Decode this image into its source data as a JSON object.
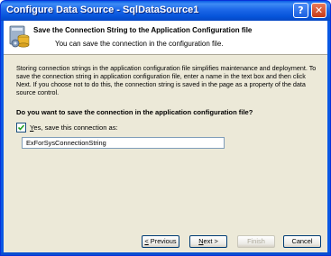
{
  "window": {
    "title": "Configure Data Source - SqlDataSource1",
    "help_label": "?",
    "close_label": "✕"
  },
  "header": {
    "title": "Save the Connection String to the Application Configuration file",
    "subtitle": "You can save the connection in the configuration file."
  },
  "body": {
    "description": "Storing connection strings in the application configuration file simplifies maintenance and deployment. To save the connection string in application configuration file, enter a name in the text box and then click Next. If you choose not to do this, the connection string is saved in the page as a property of the data source control.",
    "question": "Do you want to save the connection in the application configuration file?",
    "checkbox": {
      "checked": true,
      "label_accel": "Y",
      "label_rest": "es, save this connection as:"
    },
    "connection_name": "ExForSysConnectionString"
  },
  "buttons": {
    "previous": {
      "accel": "<",
      "rest": " Previous"
    },
    "next": {
      "pre": "",
      "accel": "N",
      "rest": "ext >"
    },
    "finish": "Finish",
    "cancel": "Cancel"
  }
}
